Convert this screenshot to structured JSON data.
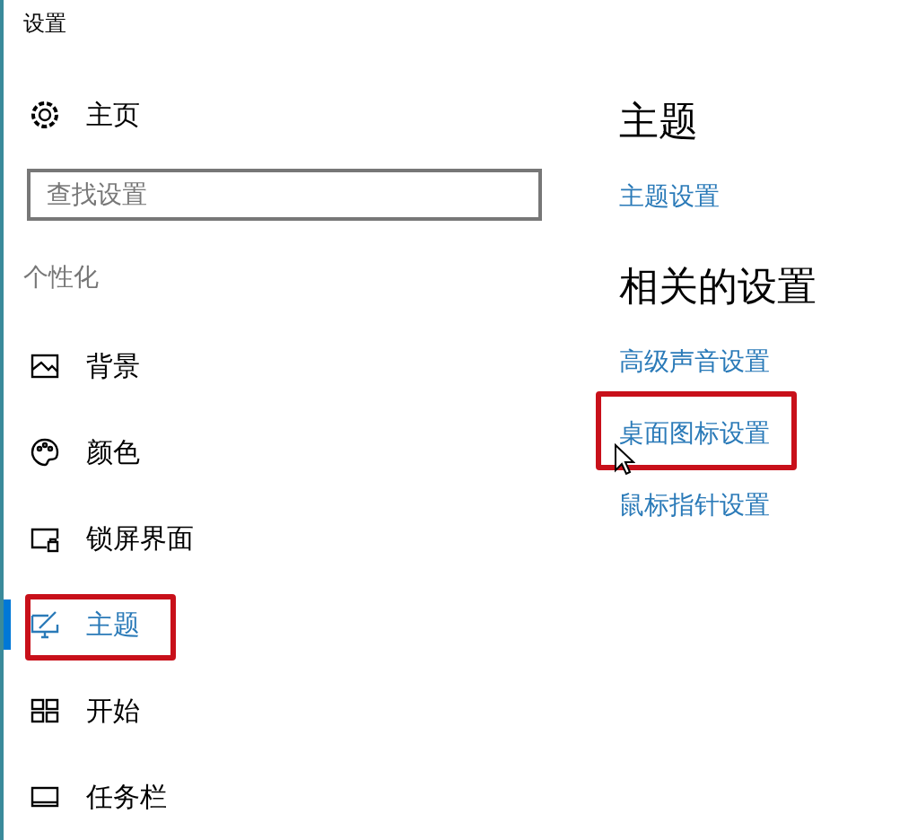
{
  "window": {
    "title": "设置"
  },
  "home": {
    "label": "主页"
  },
  "search": {
    "placeholder": "查找设置"
  },
  "section": "个性化",
  "nav": [
    {
      "label": "背景",
      "kind": "picture",
      "selected": false,
      "highlighted": false
    },
    {
      "label": "颜色",
      "kind": "palette",
      "selected": false,
      "highlighted": false
    },
    {
      "label": "锁屏界面",
      "kind": "lock",
      "selected": false,
      "highlighted": false
    },
    {
      "label": "主题",
      "kind": "brush",
      "selected": true,
      "highlighted": true
    },
    {
      "label": "开始",
      "kind": "grid",
      "selected": false,
      "highlighted": false
    },
    {
      "label": "任务栏",
      "kind": "taskbar",
      "selected": false,
      "highlighted": false
    }
  ],
  "main": {
    "heading": "主题",
    "links": [
      {
        "label": "主题设置",
        "highlighted": false,
        "hovered": false
      }
    ],
    "related_heading": "相关的设置",
    "related_links": [
      {
        "label": "高级声音设置",
        "highlighted": false,
        "hovered": false
      },
      {
        "label": "桌面图标设置",
        "highlighted": true,
        "hovered": true
      },
      {
        "label": "鼠标指针设置",
        "highlighted": false,
        "hovered": false
      }
    ]
  }
}
